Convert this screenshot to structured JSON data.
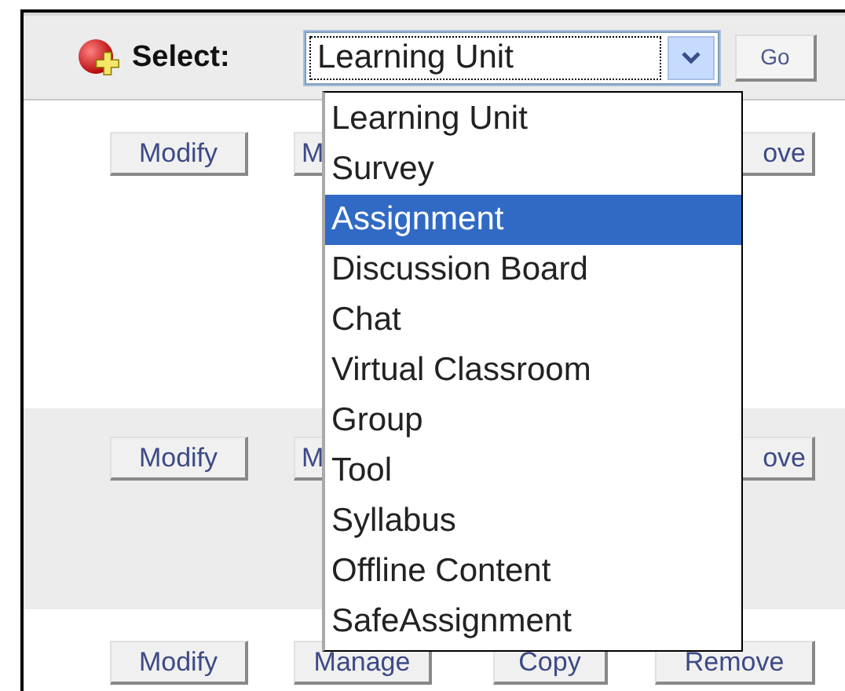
{
  "toolbar": {
    "label": "Select:",
    "select": {
      "value": "Learning Unit",
      "expanded": true
    },
    "go_button": "Go"
  },
  "dropdown": {
    "options": [
      {
        "label": "Learning Unit",
        "selected": false
      },
      {
        "label": "Survey",
        "selected": false
      },
      {
        "label": "Assignment",
        "selected": true
      },
      {
        "label": "Discussion Board",
        "selected": false
      },
      {
        "label": "Chat",
        "selected": false
      },
      {
        "label": "Virtual Classroom",
        "selected": false
      },
      {
        "label": "Group",
        "selected": false
      },
      {
        "label": "Tool",
        "selected": false
      },
      {
        "label": "Syllabus",
        "selected": false
      },
      {
        "label": "Offline Content",
        "selected": false
      },
      {
        "label": "SafeAssignment",
        "selected": false
      }
    ]
  },
  "rows": [
    {
      "shaded": false,
      "buttons": [
        {
          "label": "Modify",
          "clipped_right": false,
          "clipped_left": false
        },
        {
          "label": "M",
          "clipped_right": true,
          "clipped_left": false
        },
        {
          "label": "ove",
          "clipped_right": false,
          "clipped_left": true
        }
      ]
    },
    {
      "shaded": true,
      "buttons": [
        {
          "label": "Modify",
          "clipped_right": false,
          "clipped_left": false
        },
        {
          "label": "M",
          "clipped_right": true,
          "clipped_left": false
        },
        {
          "label": "ove",
          "clipped_right": false,
          "clipped_left": true
        }
      ]
    },
    {
      "shaded": false,
      "buttons": [
        {
          "label": "Modify",
          "clipped_right": false,
          "clipped_left": false
        },
        {
          "label": "Manage",
          "clipped_right": false,
          "clipped_left": false
        },
        {
          "label": "Copy",
          "clipped_right": false,
          "clipped_left": false
        },
        {
          "label": "Remove",
          "clipped_right": false,
          "clipped_left": false
        }
      ]
    }
  ]
}
